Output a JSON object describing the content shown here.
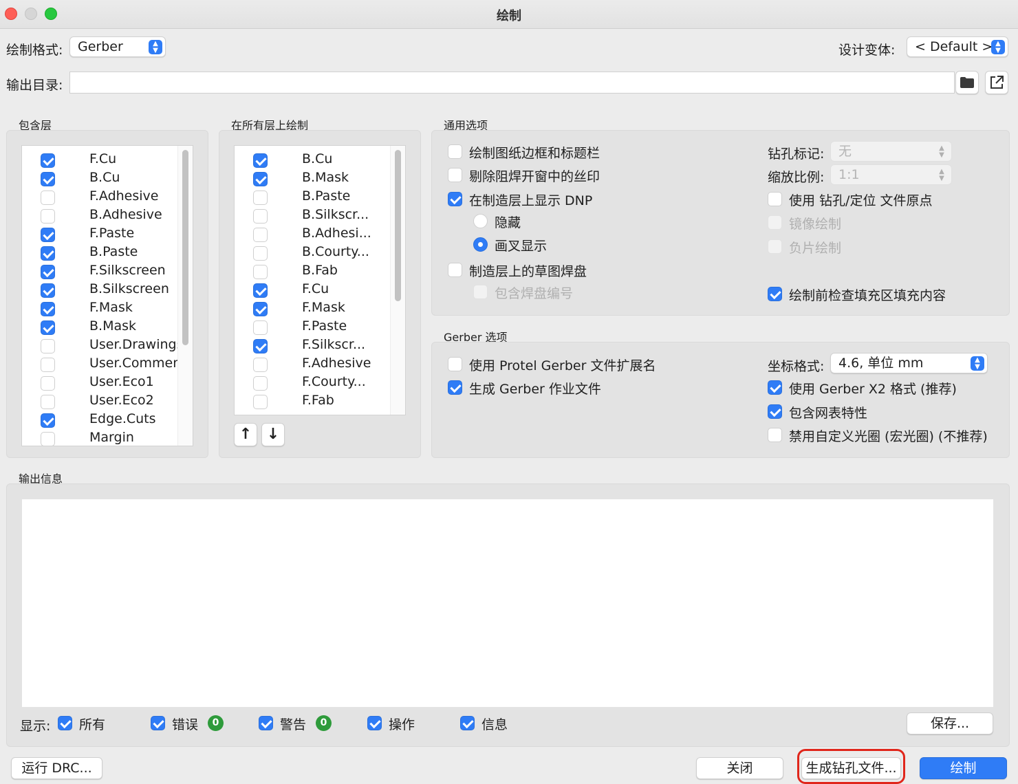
{
  "window": {
    "title": "绘制"
  },
  "top": {
    "format_label": "绘制格式:",
    "format_value": "Gerber",
    "variant_label": "设计变体:",
    "variant_value": "< Default >",
    "output_dir_label": "输出目录:",
    "output_dir_value": ""
  },
  "include_layers": {
    "title": "包含层",
    "items": [
      {
        "label": "F.Cu",
        "checked": true
      },
      {
        "label": "B.Cu",
        "checked": true
      },
      {
        "label": "F.Adhesive",
        "checked": false
      },
      {
        "label": "B.Adhesive",
        "checked": false
      },
      {
        "label": "F.Paste",
        "checked": true
      },
      {
        "label": "B.Paste",
        "checked": true
      },
      {
        "label": "F.Silkscreen",
        "checked": true
      },
      {
        "label": "B.Silkscreen",
        "checked": true
      },
      {
        "label": "F.Mask",
        "checked": true
      },
      {
        "label": "B.Mask",
        "checked": true
      },
      {
        "label": "User.Drawings",
        "checked": false
      },
      {
        "label": "User.Commen",
        "checked": false
      },
      {
        "label": "User.Eco1",
        "checked": false
      },
      {
        "label": "User.Eco2",
        "checked": false
      },
      {
        "label": "Edge.Cuts",
        "checked": true
      },
      {
        "label": "Margin",
        "checked": false
      }
    ]
  },
  "all_layers": {
    "title": "在所有层上绘制",
    "items": [
      {
        "label": "B.Cu",
        "checked": true
      },
      {
        "label": "B.Mask",
        "checked": true
      },
      {
        "label": "B.Paste",
        "checked": false
      },
      {
        "label": "B.Silkscr...",
        "checked": false
      },
      {
        "label": "B.Adhesi...",
        "checked": false
      },
      {
        "label": "B.Courty...",
        "checked": false
      },
      {
        "label": "B.Fab",
        "checked": false
      },
      {
        "label": "F.Cu",
        "checked": true
      },
      {
        "label": "F.Mask",
        "checked": true
      },
      {
        "label": "F.Paste",
        "checked": false
      },
      {
        "label": "F.Silkscr...",
        "checked": true
      },
      {
        "label": "F.Adhesive",
        "checked": false
      },
      {
        "label": "F.Courty...",
        "checked": false
      },
      {
        "label": "F.Fab",
        "checked": false
      }
    ],
    "up_glyph": "↑",
    "down_glyph": "↓"
  },
  "general": {
    "title": "通用选项",
    "plot_border": "绘制图纸边框和标题栏",
    "remove_silk": "剔除阻焊开窗中的丝印",
    "show_dnp": "在制造层上显示 DNP",
    "dnp_hide": "隐藏",
    "dnp_cross": "画叉显示",
    "sketch_pads": "制造层上的草图焊盘",
    "pad_numbers": "包含焊盘编号",
    "drill_marks_label": "钻孔标记:",
    "drill_marks_value": "无",
    "scale_label": "缩放比例:",
    "scale_value": "1:1",
    "aux_origin": "使用 钻孔/定位 文件原点",
    "mirror": "镜像绘制",
    "negative": "负片绘制",
    "check_zone": "绘制前检查填充区填充内容"
  },
  "gerber": {
    "title": "Gerber 选项",
    "protel_ext": "使用 Protel Gerber 文件扩展名",
    "job_file": "生成 Gerber 作业文件",
    "coord_label": "坐标格式:",
    "coord_value": "4.6, 单位 mm",
    "x2": "使用 Gerber X2 格式 (推荐)",
    "netlist": "包含网表特性",
    "disable_aperture": "禁用自定义光圈 (宏光圈) (不推荐)"
  },
  "output": {
    "title": "输出信息",
    "show_label": "显示:",
    "filter_all": "所有",
    "filter_errors": "错误",
    "errors_count": "0",
    "filter_warnings": "警告",
    "warnings_count": "0",
    "filter_actions": "操作",
    "filter_info": "信息",
    "save_button": "保存..."
  },
  "footer": {
    "run_drc": "运行 DRC...",
    "close": "关闭",
    "gen_drill": "生成钻孔文件...",
    "plot": "绘制"
  },
  "colors": {
    "accent": "#2f7cf6",
    "highlight": "#e0261b",
    "badge": "#2e9b3b"
  }
}
